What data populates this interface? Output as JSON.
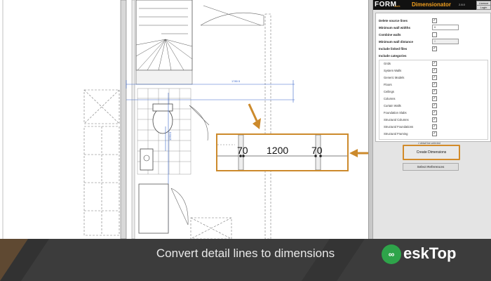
{
  "panel": {
    "logo": "FORM",
    "logo_sub": "work",
    "title": "Dimensionator",
    "version": "2.8.0",
    "header_buttons": [
      "Licence",
      "Login"
    ],
    "options": [
      {
        "label": "Delete source lines",
        "checked": true
      },
      {
        "label": "Minimum wall widths",
        "value": "0"
      },
      {
        "label": "Combine walls",
        "checked": false
      },
      {
        "label": "Minimum wall distance",
        "value": "0"
      },
      {
        "label": "Include linked files",
        "checked": true
      },
      {
        "label": "Include categories"
      }
    ],
    "categories": [
      {
        "label": "Grids",
        "checked": true
      },
      {
        "label": "System Walls",
        "checked": true
      },
      {
        "label": "Generic Models",
        "checked": true
      },
      {
        "label": "Floors",
        "checked": true
      },
      {
        "label": "Ceilings",
        "checked": true
      },
      {
        "label": "Columns",
        "checked": true
      },
      {
        "label": "Curtain Walls",
        "checked": true
      },
      {
        "label": "Foundation Slabs",
        "checked": true
      },
      {
        "label": "Structural Columns",
        "checked": true
      },
      {
        "label": "Structural Foundations",
        "checked": true
      },
      {
        "label": "Structural Framing",
        "checked": true
      }
    ],
    "status": "1 detail line selected",
    "create_label": "Create Dimensions",
    "select_label": "Select References"
  },
  "drawing": {
    "zoom_dims": [
      "70",
      "1200",
      "70"
    ],
    "dim_small_1": "1780.5",
    "dim_small_2": "1250.0"
  },
  "caption": "Convert detail lines to dimensions",
  "watermark": {
    "icon": "∞",
    "text": "eskTop"
  },
  "colors": {
    "accent": "#cc8a2c",
    "banner": "#3c3c3c",
    "watermark_green": "#2ea44a"
  }
}
